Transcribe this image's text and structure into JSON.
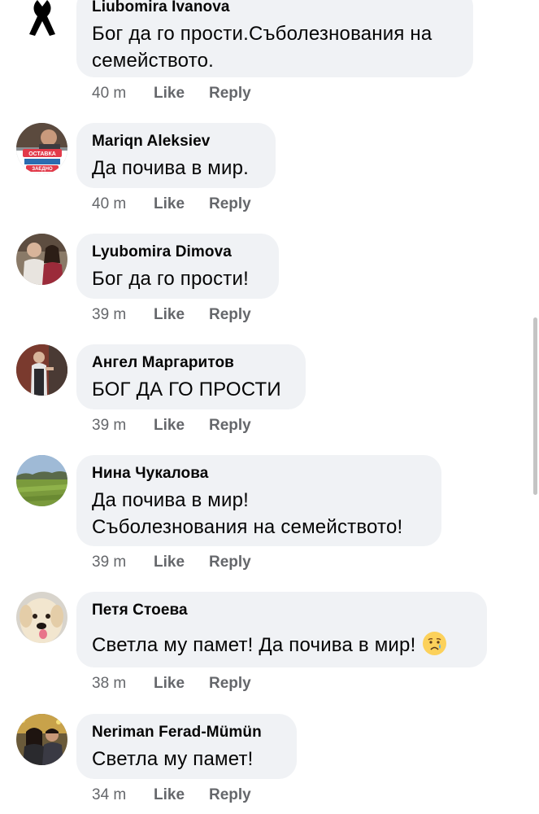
{
  "comments": [
    {
      "author": "Liubomira Ivanova",
      "text_lines": [
        "Бог да го прости.Съболезнования на",
        "семейството."
      ],
      "time": "40 m",
      "like": "Like",
      "reply": "Reply"
    },
    {
      "author": "Mariqn Aleksiev",
      "text_lines": [
        "Да почива в мир."
      ],
      "time": "40 m",
      "like": "Like",
      "reply": "Reply"
    },
    {
      "author": "Lyubomira Dimova",
      "text_lines": [
        "Бог да го прости!"
      ],
      "time": "39 m",
      "like": "Like",
      "reply": "Reply"
    },
    {
      "author": "Ангел Маргаритов",
      "text_lines": [
        "БОГ ДА ГО ПРОСТИ"
      ],
      "time": "39 m",
      "like": "Like",
      "reply": "Reply"
    },
    {
      "author": "Нина Чукалова",
      "text_lines": [
        "Да почива в мир!",
        "Съболезнования на семейството!"
      ],
      "time": "39 m",
      "like": "Like",
      "reply": "Reply"
    },
    {
      "author": "Петя Стоева",
      "text_lines": [
        "Светла му памет! Да почива в мир! "
      ],
      "emoji": "sad-but-relieved-face-icon",
      "time": "38 m",
      "like": "Like",
      "reply": "Reply"
    },
    {
      "author": "Neriman Ferad-Mümün",
      "text_lines": [
        "Светла му памет!"
      ],
      "time": "34 m",
      "like": "Like",
      "reply": "Reply"
    }
  ],
  "avatar_badge_text": [
    "ОСТАВКА",
    "ЗАЕДНО"
  ],
  "colors": {
    "bubble": "#f0f2f5",
    "meta_text": "#65676b",
    "text": "#050505"
  }
}
